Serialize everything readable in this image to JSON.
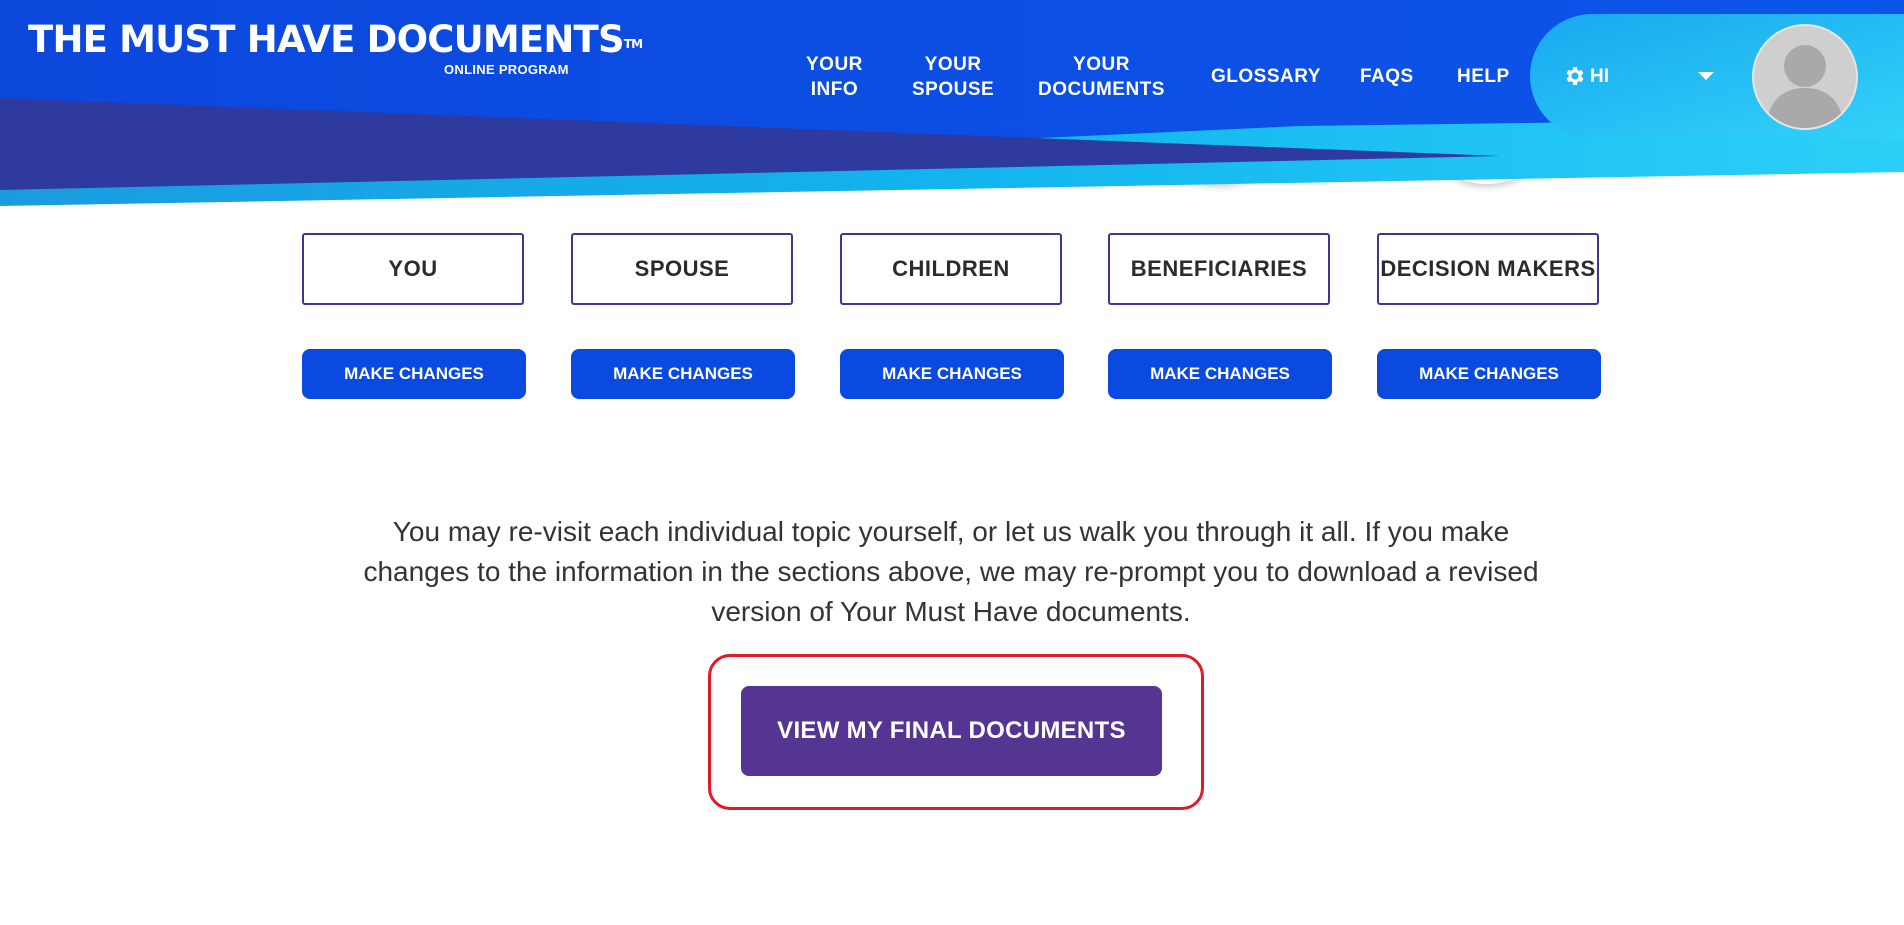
{
  "header": {
    "logo_title": "THE MUST HAVE DOCUMENTS",
    "logo_tm": "TM",
    "logo_subtitle": "ONLINE PROGRAM",
    "nav": [
      {
        "line1": "YOUR",
        "line2": "INFO"
      },
      {
        "line1": "YOUR",
        "line2": "SPOUSE"
      },
      {
        "line1": "YOUR",
        "line2": "DOCUMENTS"
      },
      {
        "line1": "GLOSSARY"
      },
      {
        "line1": "FAQS"
      },
      {
        "line1": "HELP"
      }
    ],
    "user_greeting": "HI"
  },
  "sections": [
    {
      "label": "YOU",
      "button": "MAKE CHANGES"
    },
    {
      "label": "SPOUSE",
      "button": "MAKE CHANGES"
    },
    {
      "label": "CHILDREN",
      "button": "MAKE CHANGES"
    },
    {
      "label": "BENEFICIARIES",
      "button": "MAKE CHANGES"
    },
    {
      "label": "DECISION MAKERS",
      "button": "MAKE CHANGES"
    }
  ],
  "info_text": "You may re-visit each individual topic yourself, or let us walk you through it all. If you make changes to the information in the sections above, we may re-prompt you to download a revised version of Your Must Have documents.",
  "final_button": "VIEW MY FINAL DOCUMENTS",
  "colors": {
    "header_blue": "#0a4ae0",
    "header_cyan": "#1ec8f5",
    "accent_purple": "#553592",
    "highlight_red": "#e01a2a"
  }
}
